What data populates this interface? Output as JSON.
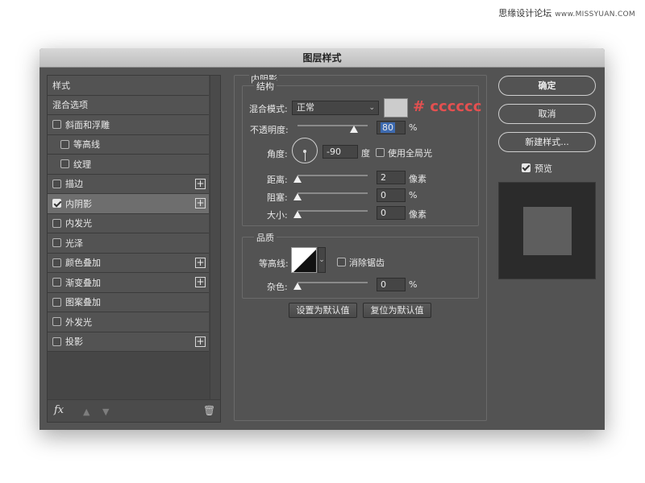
{
  "watermark": {
    "text": "思缘设计论坛",
    "site": "www.MISSYUAN.COM"
  },
  "dialog": {
    "title": "图层样式"
  },
  "styles_panel": {
    "items": [
      {
        "label": "样式",
        "checkbox": false,
        "checked": false,
        "plus": false,
        "indent": 0,
        "active": false
      },
      {
        "label": "混合选项",
        "checkbox": false,
        "checked": false,
        "plus": false,
        "indent": 0,
        "active": false
      },
      {
        "label": "斜面和浮雕",
        "checkbox": true,
        "checked": false,
        "plus": false,
        "indent": 0,
        "active": false
      },
      {
        "label": "等高线",
        "checkbox": true,
        "checked": false,
        "plus": false,
        "indent": 1,
        "active": false
      },
      {
        "label": "纹理",
        "checkbox": true,
        "checked": false,
        "plus": false,
        "indent": 1,
        "active": false
      },
      {
        "label": "描边",
        "checkbox": true,
        "checked": false,
        "plus": true,
        "indent": 0,
        "active": false
      },
      {
        "label": "内阴影",
        "checkbox": true,
        "checked": true,
        "plus": true,
        "indent": 0,
        "active": true
      },
      {
        "label": "内发光",
        "checkbox": true,
        "checked": false,
        "plus": false,
        "indent": 0,
        "active": false
      },
      {
        "label": "光泽",
        "checkbox": true,
        "checked": false,
        "plus": false,
        "indent": 0,
        "active": false
      },
      {
        "label": "颜色叠加",
        "checkbox": true,
        "checked": false,
        "plus": true,
        "indent": 0,
        "active": false
      },
      {
        "label": "渐变叠加",
        "checkbox": true,
        "checked": false,
        "plus": true,
        "indent": 0,
        "active": false
      },
      {
        "label": "图案叠加",
        "checkbox": true,
        "checked": false,
        "plus": false,
        "indent": 0,
        "active": false
      },
      {
        "label": "外发光",
        "checkbox": true,
        "checked": false,
        "plus": false,
        "indent": 0,
        "active": false
      },
      {
        "label": "投影",
        "checkbox": true,
        "checked": false,
        "plus": true,
        "indent": 0,
        "active": false
      }
    ],
    "footer": {
      "fx": "fx",
      "up_icon": "arrow-up-icon",
      "down_icon": "arrow-down-icon",
      "trash_icon": "trash-icon"
    }
  },
  "inner_shadow": {
    "title": "内阴影",
    "structure": {
      "title": "结构",
      "blend_mode_label": "混合模式:",
      "blend_mode_value": "正常",
      "color_swatch": "#cccccc",
      "color_note": "# cccccc",
      "opacity_label": "不透明度:",
      "opacity_value": "80",
      "opacity_percent": 80,
      "percent": "%",
      "angle_label": "角度:",
      "angle_value": "-90",
      "angle_unit": "度",
      "global_light_label": "使用全局光",
      "global_light_checked": false,
      "distance_label": "距离:",
      "distance_value": "2",
      "pixels": "像素",
      "choke_label": "阻塞:",
      "choke_value": "0",
      "size_label": "大小:",
      "size_value": "0"
    },
    "quality": {
      "title": "品质",
      "contour_label": "等高线:",
      "anti_alias_label": "消除锯齿",
      "anti_alias_checked": false,
      "noise_label": "杂色:",
      "noise_value": "0"
    },
    "set_default": "设置为默认值",
    "reset_default": "复位为默认值"
  },
  "actions": {
    "ok": "确定",
    "cancel": "取消",
    "new_style": "新建样式...",
    "preview_label": "预览",
    "preview_checked": true
  }
}
